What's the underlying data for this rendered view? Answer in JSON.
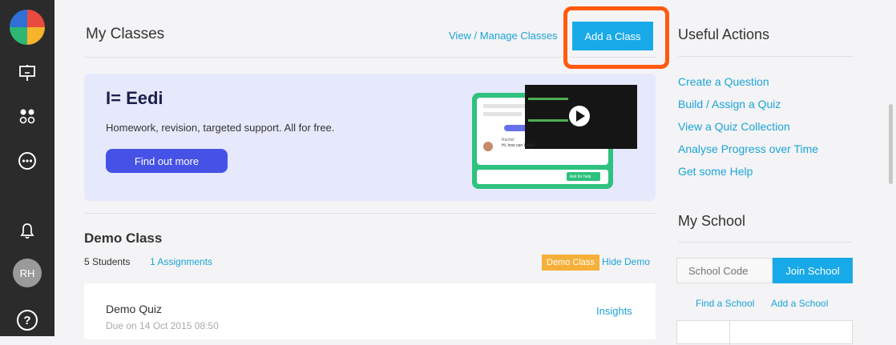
{
  "sidebar": {
    "avatar_initials": "RH",
    "icons": [
      "app-logo",
      "presentation-icon",
      "apps-grid-icon",
      "more-icon",
      "bell-icon",
      "avatar",
      "help-icon"
    ]
  },
  "header": {
    "title": "My Classes",
    "view_manage_label": "View / Manage Classes",
    "add_class_label": "Add a Class",
    "annotation_color": "#ff5a10"
  },
  "banner": {
    "brand": "I= Eedi",
    "text": "Homework, revision, targeted support. All for free.",
    "button_label": "Find out more",
    "promo": {
      "chat_name": "Rachel",
      "chat_message": "Hi, how can I help?",
      "ask_button": "Ask for help"
    }
  },
  "demo_class": {
    "title": "Demo Class",
    "students": "5 Students",
    "assignments": "1 Assignments",
    "badge": "Demo Class",
    "hide_label": "Hide Demo",
    "quiz": {
      "title": "Demo Quiz",
      "due": "Due on 14 Oct 2015 08:50",
      "insights_label": "Insights"
    }
  },
  "useful_actions": {
    "title": "Useful Actions",
    "links": [
      "Create a Question",
      "Build / Assign a Quiz",
      "View a Quiz Collection",
      "Analyse Progress over Time",
      "Get some Help"
    ]
  },
  "my_school": {
    "title": "My School",
    "code_placeholder": "School Code",
    "join_label": "Join School",
    "find_label": "Find a School",
    "add_label": "Add a School"
  },
  "colors": {
    "accent": "#18a9e8",
    "link": "#1ba3d8",
    "sidebar": "#2b2b2b",
    "banner_bg": "#e6e8fb",
    "banner_button": "#4652e6",
    "demo_badge": "#f6b03a"
  }
}
